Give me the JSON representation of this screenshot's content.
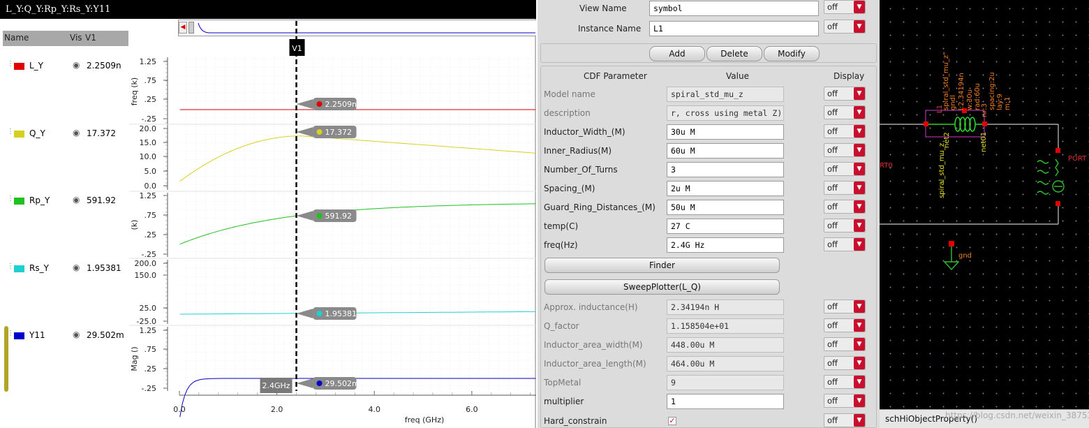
{
  "waveform": {
    "title": "L_Y:Q_Y:Rp_Y:Rs_Y:Y11",
    "columns": {
      "name": "Name",
      "vis": "Vis",
      "value": "V1"
    },
    "marker_label": "V1",
    "marker_x_label": "2.4GHz",
    "marker_x_value": 2.4,
    "x_axis": {
      "label": "freq (GHz)",
      "ticks": [
        "0.0",
        "2.0",
        "4.0",
        "6.0"
      ],
      "range": [
        0,
        7.5
      ]
    },
    "signals": [
      {
        "name": "L_Y",
        "value": "2.2509n",
        "color": "#e00000",
        "ylabel": "freq (k)",
        "ticks": [
          "1.25",
          ".75",
          ".25",
          "-.25"
        ],
        "marker": "2.2509n"
      },
      {
        "name": "Q_Y",
        "value": "17.372",
        "color": "#d8d020",
        "ylabel": "",
        "ticks": [
          "20.0",
          "15.0",
          "10.0",
          "5.0",
          "0.0"
        ],
        "marker": "17.372"
      },
      {
        "name": "Rp_Y",
        "value": "591.92",
        "color": "#20c020",
        "ylabel": "(k)",
        "ticks": [
          "1.25",
          ".75",
          ".25",
          "-.25"
        ],
        "marker": "591.92"
      },
      {
        "name": "Rs_Y",
        "value": "1.95381",
        "color": "#20d0d0",
        "ylabel": "",
        "ticks": [
          "200.0",
          "150.0",
          "25.0",
          "-25.0"
        ],
        "marker": "1.95381"
      },
      {
        "name": "Y11",
        "value": "29.502m",
        "color": "#0000c8",
        "ylabel": "Mag ()",
        "ticks": [
          "1.25",
          ".75",
          ".25",
          "-.25"
        ],
        "marker": "29.502m"
      }
    ]
  },
  "property_editor": {
    "view_name": {
      "label": "View Name",
      "value": "symbol",
      "display": "off"
    },
    "instance_name": {
      "label": "Instance Name",
      "value": "L1",
      "display": "off"
    },
    "buttons": {
      "add": "Add",
      "delete": "Delete",
      "modify": "Modify",
      "finder": "Finder",
      "sweep": "SweepPlotter(L_Q)"
    },
    "headers": {
      "param": "CDF Parameter",
      "value": "Value",
      "display": "Display"
    },
    "params_top": [
      {
        "label": "Model name",
        "value": "spiral_std_mu_z",
        "display": "off",
        "readonly": true
      },
      {
        "label": "description",
        "value": "r, cross using metal Z)",
        "display": "off",
        "readonly": true
      },
      {
        "label": "Inductor_Width_(M)",
        "value": "30u M",
        "display": "off",
        "readonly": false
      },
      {
        "label": "Inner_Radius(M)",
        "value": "60u M",
        "display": "off",
        "readonly": false
      },
      {
        "label": "Number_Of_Turns",
        "value": "3",
        "display": "off",
        "readonly": false
      },
      {
        "label": "Spacing_(M)",
        "value": "2u M",
        "display": "off",
        "readonly": false
      },
      {
        "label": "Guard_Ring_Distances_(M)",
        "value": "50u M",
        "display": "off",
        "readonly": false
      },
      {
        "label": "temp(C)",
        "value": "27 C",
        "display": "off",
        "readonly": false
      },
      {
        "label": "freq(Hz)",
        "value": "2.4G Hz",
        "display": "off",
        "readonly": false
      }
    ],
    "params_bottom": [
      {
        "label": "Approx. inductance(H)",
        "value": "2.34194n H",
        "display": "off",
        "readonly": true
      },
      {
        "label": "Q_factor",
        "value": "1.158504e+01",
        "display": "off",
        "readonly": true
      },
      {
        "label": "Inductor_area_width(M)",
        "value": "448.00u M",
        "display": "off",
        "readonly": true
      },
      {
        "label": "Inductor_area_length(M)",
        "value": "464.00u M",
        "display": "off",
        "readonly": true
      },
      {
        "label": "TopMetal",
        "value": "9",
        "display": "off",
        "readonly": true
      },
      {
        "label": "multiplier",
        "value": "1",
        "display": "off",
        "readonly": false
      }
    ],
    "hard_constrain": {
      "label": "Hard_constrain",
      "checked": "✓",
      "display": "off"
    }
  },
  "schematic": {
    "inst_label": "L1",
    "props": [
      "spiral_std_mu_z\"",
      "gndl",
      "l:2.34194n",
      "w:30u",
      "rad:60u",
      "nr:3",
      "spacing:2u",
      "lay:9",
      "m:1"
    ],
    "model_vertical": "spiral_std_mu_z",
    "net2": "net2",
    "net01": "net01",
    "port_left": "RT0",
    "port_right": "PORT",
    "gnd": "gnd",
    "status": "schHiObjectProperty()",
    "watermark": "https://blog.csdn.net/weixin_38753095"
  }
}
